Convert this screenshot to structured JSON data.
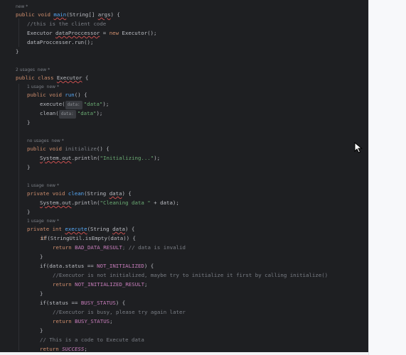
{
  "hints": {
    "new": "new *",
    "two_usages_new": "2 usages  new *",
    "one_usage_new": "1 usage  new *",
    "no_usages_new": "no usages  new *"
  },
  "code": {
    "l_main_sig_a": "public void ",
    "l_main_name": "main",
    "l_main_sig_b": "(String[] ",
    "l_main_arg": "args",
    "l_main_sig_c": ") {",
    "l_comment_client": "//this is the client code",
    "l_exec_decl_a": "Executor ",
    "l_exec_decl_var": "dataProccessor",
    "l_exec_decl_b": " = ",
    "l_exec_decl_new": "new",
    "l_exec_decl_c": " Executor();",
    "l_run_call": "dataProccesser.run();",
    "close": "}",
    "class_a": "public class ",
    "class_name": "Executor",
    "class_b": " {",
    "run_a": "public void ",
    "run_name": "run",
    "run_b": "() {",
    "exec_call": "execute(",
    "hint_data": "data:",
    "str_data": "\"data\"",
    "call_end": ");",
    "clean_call": "clean(",
    "init_a": "public void ",
    "init_name": "initialize",
    "init_b": "() {",
    "sys_out": "System.out",
    "println_a": ".println(",
    "str_initializing": "\"Initializing...\"",
    "clean_decl_a": "private void ",
    "clean_decl_name": "clean",
    "clean_decl_b": "(String ",
    "param_data": "data",
    "clean_decl_c": ") {",
    "str_cleaning": "\"Cleaning data \"",
    "plus_data": " + data);",
    "exec_decl_a": "private int ",
    "exec_decl_name": "execute",
    "exec_decl_b": "(String ",
    "exec_decl_c": ") {",
    "if_empty": "if(StringUtil.isEmpty(data)) {",
    "return_kw": "return ",
    "bad_result": "BAD_DATA_RESULT",
    "bad_comment": "; // data is invalid",
    "if_status_a": "if(data.status == ",
    "not_init": "NOT_INITIALIZED",
    "if_status_b": ") {",
    "comment_not_init": "//Executor is not initialized, maybe try to initialize it first by calling initialize()",
    "not_init_result": "NOT_INITIALIZED_RESULT",
    "semi": ";",
    "if_busy_a": "if(status == ",
    "busy_status": "BUSY_STATUS",
    "if_busy_b": ") {",
    "comment_busy": "//Executor is busy, please try again later",
    "busy_status_ret": "BUSY_STATUS",
    "comment_execute": "// This is a code to Execute data",
    "success": "SUCCESS"
  }
}
